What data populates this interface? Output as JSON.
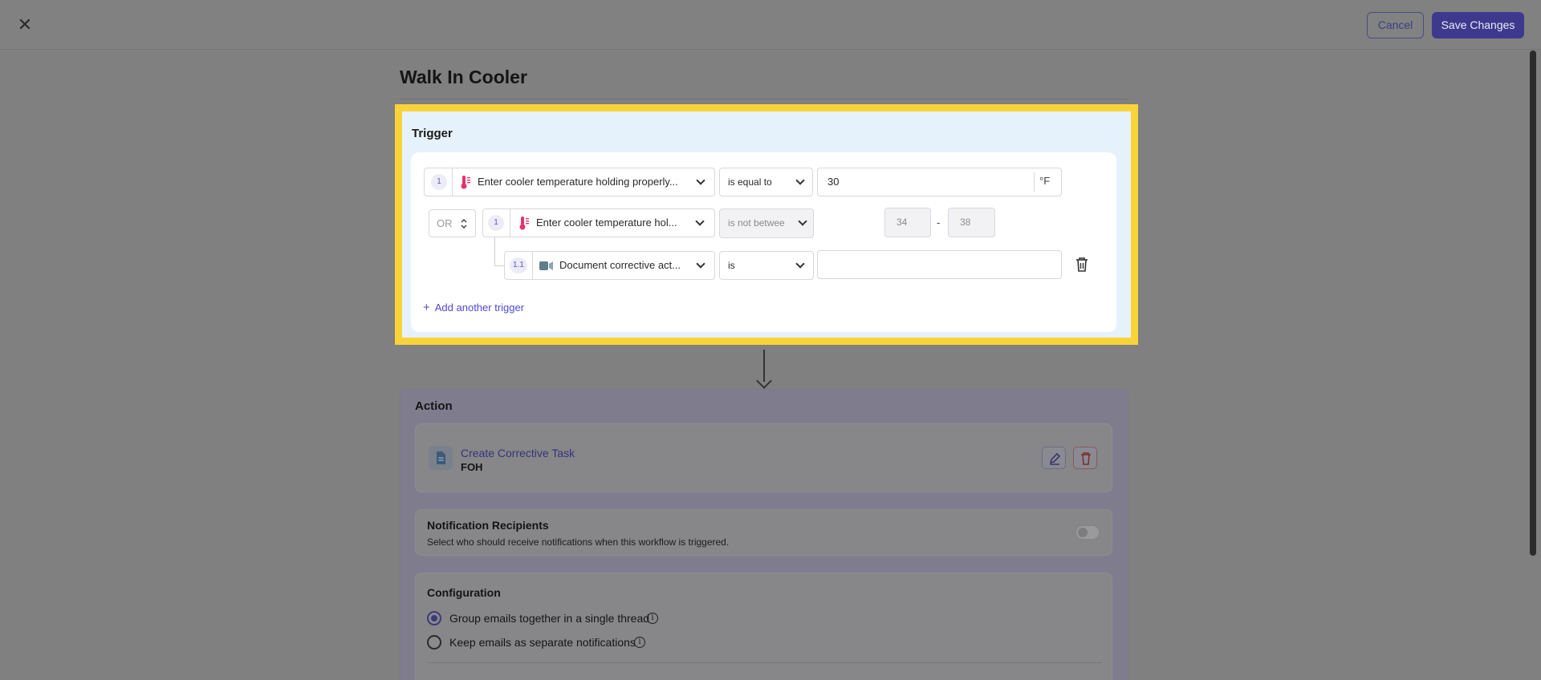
{
  "header": {
    "close_glyph": "✕",
    "cancel_label": "Cancel",
    "save_label": "Save Changes"
  },
  "page": {
    "title": "Walk In Cooler"
  },
  "trigger": {
    "title": "Trigger",
    "row1": {
      "number": "1",
      "question": "Enter cooler temperature holding properly...",
      "operator": "is equal to",
      "value": "30",
      "unit": "°F",
      "icon": "thermometer-icon"
    },
    "or_select": {
      "value": "OR"
    },
    "row2": {
      "number": "1",
      "question": "Enter cooler temperature hol...",
      "operator": "is not betwee",
      "min": "34",
      "dash": "-",
      "max": "38",
      "icon": "thermometer-icon"
    },
    "row3": {
      "number": "1.1",
      "question": "Document corrective act...",
      "operator": "is",
      "value": "",
      "icon": "chat-icon"
    },
    "add_label": "Add another trigger"
  },
  "action": {
    "title": "Action",
    "task": {
      "link": "Create Corrective Task",
      "subtitle": "FOH"
    },
    "notifications": {
      "title": "Notification Recipients",
      "description": "Select who should receive notifications when this workflow is triggered.",
      "enabled": false
    },
    "configuration": {
      "title": "Configuration",
      "options": [
        {
          "label": "Group emails together in a single thread",
          "selected": true
        },
        {
          "label": "Keep emails as separate notifications",
          "selected": false
        }
      ]
    }
  },
  "colors": {
    "accent": "#5b55d6",
    "highlight_border": "#f9d33a",
    "trigger_panel_bg": "#e6f2fb",
    "overlay": "#808080"
  }
}
